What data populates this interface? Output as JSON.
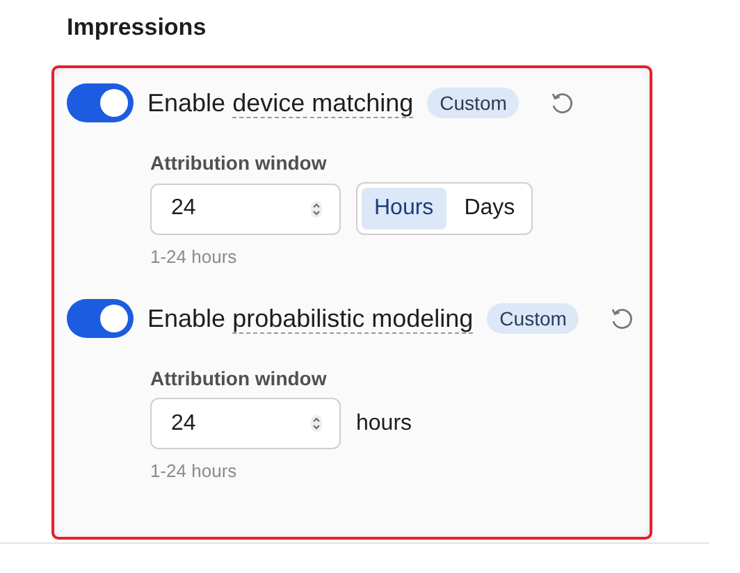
{
  "heading": "Impressions",
  "settings": [
    {
      "label": "Enable",
      "term": "device matching",
      "on": true,
      "badge": "Custom",
      "field_label": "Attribution window",
      "value": "24",
      "unit": {
        "kind": "segmented",
        "options": [
          {
            "label": "Hours",
            "selected": true
          },
          {
            "label": "Days",
            "selected": false
          }
        ]
      },
      "hint": "1-24 hours"
    },
    {
      "label": "Enable",
      "term": "probabilistic modeling",
      "on": true,
      "badge": "Custom",
      "field_label": "Attribution window",
      "value": "24",
      "unit": {
        "kind": "text",
        "text": "hours"
      },
      "hint": "1-24 hours"
    }
  ]
}
